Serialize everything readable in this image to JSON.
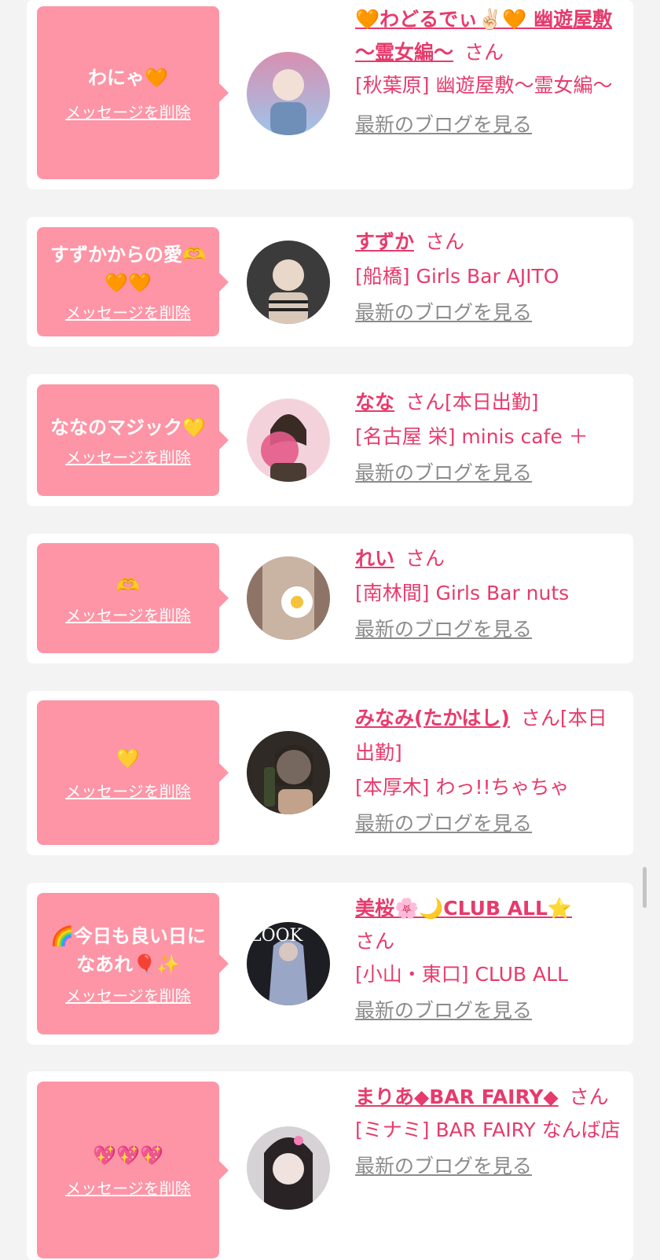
{
  "cards": [
    {
      "message": "わにゃ🧡",
      "delete_label": "メッセージを削除",
      "name": "🧡わどるでぃ✌🏻🧡 幽遊屋敷 〜霊女編〜",
      "honorific": "さん",
      "shop": "[秋葉原] 幽遊屋敷〜霊女編〜",
      "blog_link": "最新のブログを見る",
      "avatar_colors": [
        "#d88fb0",
        "#9fc4ea"
      ]
    },
    {
      "message": "すずかからの愛🫶🧡🧡",
      "delete_label": "メッセージを削除",
      "name": "すずか",
      "honorific": "さん",
      "shop": "[船橋] Girls Bar AJITO",
      "blog_link": "最新のブログを見る",
      "avatar_colors": [
        "#3b3b3b",
        "#d9c8b8"
      ]
    },
    {
      "message": "ななのマジック💛",
      "delete_label": "メッセージを削除",
      "name": "なな",
      "honorific": "さん[本日出勤]",
      "shop": "[名古屋 栄] minis cafe ＋",
      "blog_link": "最新のブログを見る",
      "avatar_colors": [
        "#e35b8a",
        "#f4d2dc"
      ]
    },
    {
      "message": "🫶",
      "delete_label": "メッセージを削除",
      "name": "れい",
      "honorific": "さん",
      "shop": "[南林間] Girls Bar nuts",
      "blog_link": "最新のブログを見る",
      "avatar_colors": [
        "#8e7467",
        "#e9e2da"
      ]
    },
    {
      "message": "💛",
      "delete_label": "メッセージを削除",
      "name": "みなみ(たかはし)",
      "honorific": "さん[本日出勤]",
      "shop": "[本厚木] わっ!!ちゃちゃ",
      "blog_link": "最新のブログを見る",
      "avatar_colors": [
        "#2f2a25",
        "#e9d3c4"
      ]
    },
    {
      "message": "🌈今日も良い日になあれ🎈✨",
      "delete_label": "メッセージを削除",
      "name": "美桜🌸🌙CLUB ALL⭐",
      "honorific": "さん",
      "shop": "[小山・東口] CLUB ALL",
      "blog_link": "最新のブログを見る",
      "avatar_colors": [
        "#1d1d24",
        "#9aa6c6"
      ]
    },
    {
      "message": "💖💖💖",
      "delete_label": "メッセージを削除",
      "name": "まりあ◆BAR FAIRY◆",
      "honorific": "さん",
      "shop": "[ミナミ] BAR FAIRY なんば店",
      "blog_link": "最新のブログを見る",
      "avatar_colors": [
        "#c9c2c6",
        "#8f7f86"
      ]
    }
  ]
}
